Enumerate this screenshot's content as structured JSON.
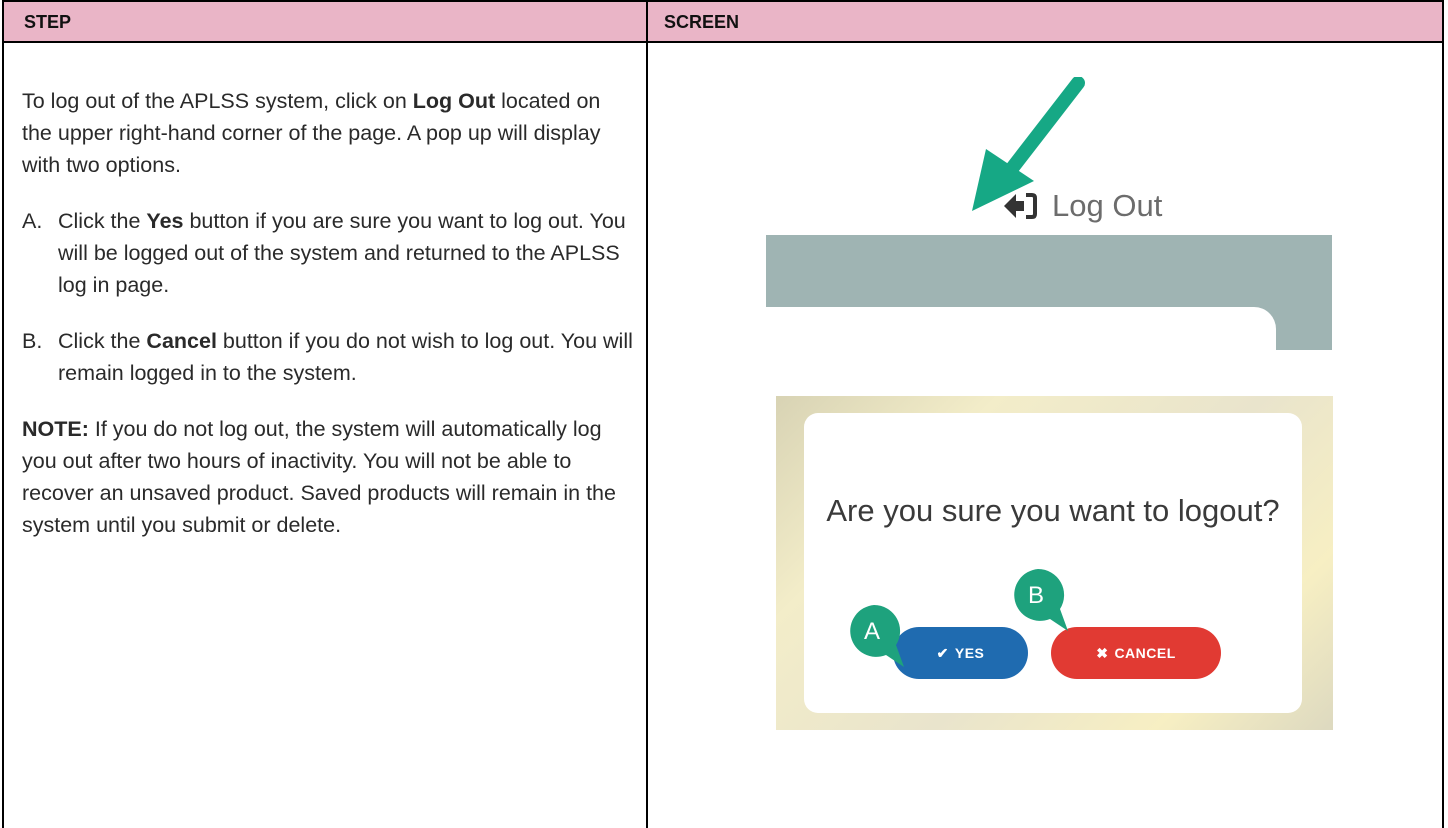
{
  "header": {
    "step": "STEP",
    "screen": "SCREEN"
  },
  "step": {
    "intro": {
      "p1": "To log out of the APLSS system, click on ",
      "b1": "Log Out",
      "p2": " located on the upper right-hand corner of the page.  A pop up will display with two options."
    },
    "item_a": {
      "marker": "A.",
      "t1": "Click the ",
      "b": "Yes",
      "t2": " button if you are sure you want to log out.  You will be logged out of the system and returned to the APLSS log in page."
    },
    "item_b": {
      "marker": "B.",
      "t1": "Click the ",
      "b": "Cancel",
      "t2": " button if you do not wish to log out.  You will remain logged in to the system."
    },
    "note": {
      "label": "NOTE:",
      "text": "  If you do not log out, the system will automatically log you out after two hours of inactivity.  You will not be able to recover an unsaved product.  Saved products will remain in the system until you submit or delete."
    }
  },
  "screen": {
    "logout_label": "Log Out",
    "question": "Are you sure you want to logout?",
    "yes_label": "YES",
    "cancel_label": "CANCEL",
    "badge_a": "A",
    "badge_b": "B",
    "colors": {
      "arrow": "#16a885",
      "badge": "#1ea27d",
      "yes": "#1f6bb0",
      "cancel": "#e13a33",
      "header": "#eab5c7"
    }
  }
}
